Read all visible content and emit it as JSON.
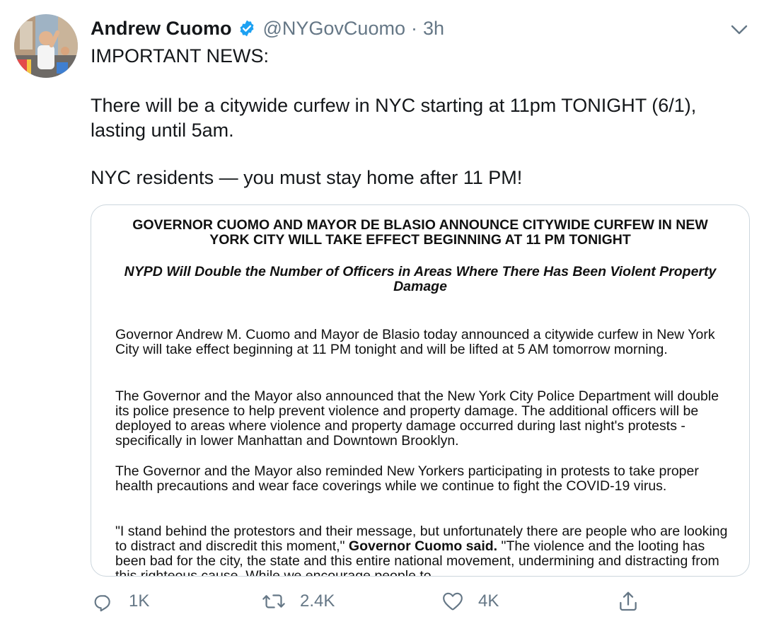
{
  "author": {
    "name": "Andrew Cuomo",
    "handle": "@NYGovCuomo",
    "separator": "·",
    "time": "3h"
  },
  "tweet": {
    "line1": "IMPORTANT NEWS:",
    "line2": "There will be a citywide curfew in NYC starting at 11pm TONIGHT (6/1), lasting until 5am.",
    "line3": "NYC residents — you must stay home after 11 PM!"
  },
  "attachment": {
    "title": "GOVERNOR CUOMO AND MAYOR DE BLASIO ANNOUNCE CITYWIDE CURFEW IN NEW YORK CITY WILL TAKE EFFECT BEGINNING AT 11 PM TONIGHT",
    "subtitle": "NYPD Will Double the Number of Officers in Areas Where There Has Been Violent Property Damage",
    "paragraph1": "Governor Andrew M. Cuomo and Mayor de Blasio today announced a citywide curfew in New York City will take effect beginning at 11 PM tonight and will be lifted at 5 AM tomorrow morning.",
    "paragraph2": "The Governor and the Mayor also announced that the New York City Police Department will double its police presence to help prevent violence and property damage. The additional officers will be deployed to areas where violence and property damage occurred during last night's protests - specifically in lower Manhattan and Downtown Brooklyn.",
    "paragraph3": "The Governor and the Mayor also reminded New Yorkers participating in protests to take proper health precautions and wear face coverings while we continue to fight the COVID-19 virus.",
    "paragraph4_part1": "\"I stand behind the protestors and their message, but unfortunately there are people who are looking to distract and discredit this moment,\" ",
    "paragraph4_bold": "Governor Cuomo said.",
    "paragraph4_part2": " \"The violence and the looting has been bad for the city, the state and this entire national movement, undermining and distracting from this righteous cause. While we encourage people to"
  },
  "actions": {
    "reply_count": "1K",
    "retweet_count": "2.4K",
    "like_count": "4K"
  },
  "icons": {
    "verified": "verified-badge-icon",
    "caret": "chevron-down-icon",
    "reply": "reply-icon",
    "retweet": "retweet-icon",
    "like": "heart-icon",
    "share": "share-icon"
  },
  "colors": {
    "verified_blue": "#1da1f2",
    "secondary_text": "#657786",
    "card_border": "#ccd6dd"
  }
}
